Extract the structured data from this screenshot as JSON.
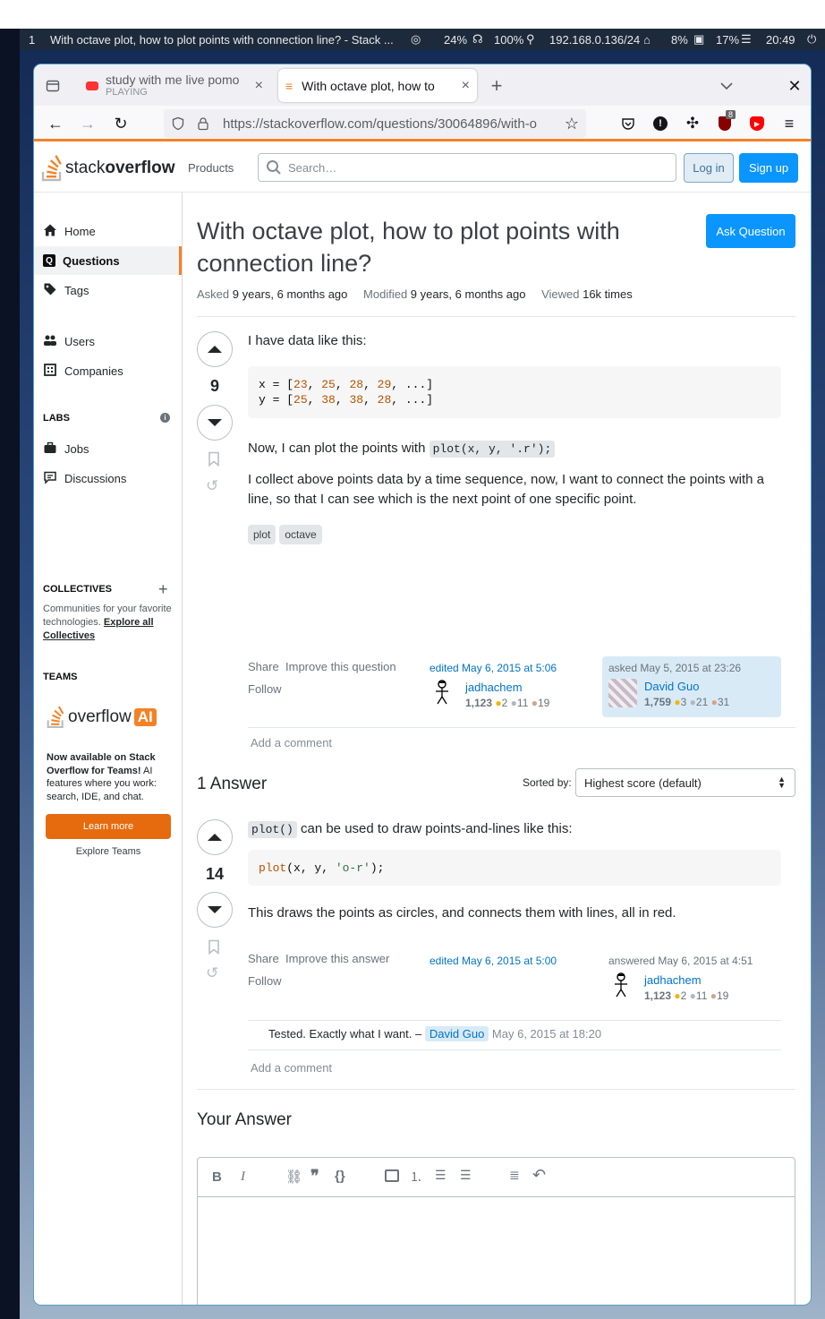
{
  "os_bar": {
    "workspace": "1",
    "window_title": "With octave plot, how to plot points with connection line? - Stack ...",
    "brightness": "24%",
    "battery": "100%",
    "network": "192.168.0.136/24",
    "cpu": "8%",
    "memory": "17%",
    "clock": "20:49"
  },
  "browser": {
    "tabs": [
      {
        "title": "study with me live pomo",
        "subtitle": "PLAYING"
      },
      {
        "title": "With octave plot, how to"
      }
    ],
    "url": "https://stackoverflow.com/questions/30064896/with-o",
    "extension_badge": "8"
  },
  "so_header": {
    "logo_text_a": "stack",
    "logo_text_b": "overflow",
    "products": "Products",
    "search_placeholder": "Search…",
    "login": "Log in",
    "signup": "Sign up"
  },
  "sidebar": {
    "home": "Home",
    "questions": "Questions",
    "tags": "Tags",
    "users": "Users",
    "companies": "Companies",
    "labs": "LABS",
    "jobs": "Jobs",
    "discussions": "Discussions",
    "collectives": "COLLECTIVES",
    "collectives_desc": "Communities for your favorite technologies.",
    "collectives_link": "Explore all Collectives",
    "teams": "TEAMS",
    "overflow_ai_a": "overflow",
    "overflow_ai_b": "AI",
    "teams_desc_bold": "Now available on Stack Overflow for Teams!",
    "teams_desc": "AI features where you work: search, IDE, and chat.",
    "learn_more": "Learn more",
    "explore_teams": "Explore Teams"
  },
  "question": {
    "title": "With octave plot, how to plot points with connection line?",
    "ask_button": "Ask Question",
    "asked_label": "Asked",
    "asked_value": "9 years, 6 months ago",
    "modified_label": "Modified",
    "modified_value": "9 years, 6 months ago",
    "viewed_label": "Viewed",
    "viewed_value": "16k times",
    "votes": "9",
    "body_intro": "I have data like this:",
    "code_x": {
      "prefix": "x = [",
      "n1": "23",
      "n2": "25",
      "n3": "28",
      "n4": "29",
      "suffix": ", ...]"
    },
    "code_y": {
      "prefix": "y = [",
      "n1": "25",
      "n2": "38",
      "n3": "38",
      "n4": "28",
      "suffix": ", ...]"
    },
    "body_p2_a": "Now, I can plot the points with",
    "body_p2_code": "plot(x, y, '.r');",
    "body_p3": "I collect above points data by a time sequence, now, I want to connect the points with a line, so that I can see which is the next point of one specific point.",
    "tags": [
      "plot",
      "octave"
    ],
    "share": "Share",
    "improve": "Improve this question",
    "follow": "Follow",
    "edited": "edited May 6, 2015 at 5:06",
    "editor_name": "jadhachem",
    "editor_rep": "1,123",
    "editor_gold": "2",
    "editor_silver": "11",
    "editor_bronze": "19",
    "asked_card": "asked May 5, 2015 at 23:26",
    "asker_name": "David Guo",
    "asker_rep": "1,759",
    "asker_gold": "3",
    "asker_silver": "21",
    "asker_bronze": "31",
    "add_comment": "Add a comment"
  },
  "answers": {
    "count_label": "1 Answer",
    "sorted_by": "Sorted by:",
    "sort_value": "Highest score (default)",
    "votes": "14",
    "code_inline": "plot()",
    "text_a": "can be used to draw points-and-lines like this:",
    "code_block": {
      "fn": "plot",
      "args": "(x, y, ",
      "str": "'o-r'",
      "end": ");"
    },
    "text_b": "This draws the points as circles, and connects them with lines, all in red.",
    "share": "Share",
    "improve": "Improve this answer",
    "follow": "Follow",
    "edited": "edited May 6, 2015 at 5:00",
    "answered": "answered May 6, 2015 at 4:51",
    "answerer_name": "jadhachem",
    "answerer_rep": "1,123",
    "answerer_gold": "2",
    "answerer_silver": "11",
    "answerer_bronze": "19",
    "comment_text": "Tested. Exactly what I want. –",
    "comment_user": "David Guo",
    "comment_date": "May 6, 2015 at 18:20",
    "add_comment": "Add a comment"
  },
  "your_answer": {
    "title": "Your Answer"
  }
}
